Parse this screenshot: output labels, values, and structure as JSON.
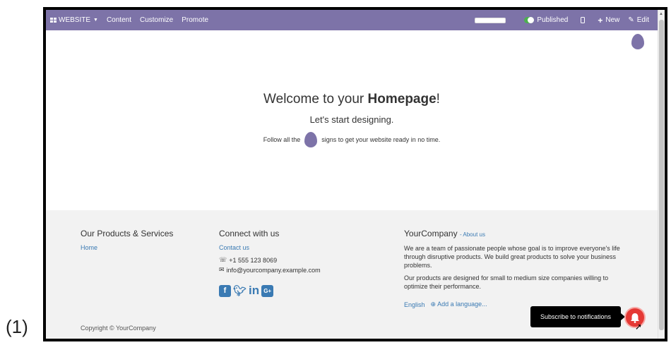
{
  "caption": "(1)",
  "topbar": {
    "website_menu": "WEBSITE",
    "content": "Content",
    "customize": "Customize",
    "promote": "Promote",
    "published": "Published",
    "new": "New",
    "edit": "Edit"
  },
  "hero": {
    "title_pre": "Welcome to your ",
    "title_bold": "Homepage",
    "title_post": "!",
    "subtitle": "Let's start designing.",
    "follow_pre": "Follow all the",
    "follow_post": "signs to get your website ready in no time."
  },
  "footer": {
    "products": {
      "heading": "Our Products & Services",
      "link": "Home"
    },
    "connect": {
      "heading": "Connect with us",
      "contact": "Contact us",
      "phone": "+1 555 123 8069",
      "email": "info@yourcompany.example.com"
    },
    "company": {
      "name": "YourCompany",
      "about": "- About us",
      "para1": "We are a team of passionate people whose goal is to improve everyone's life through disruptive products. We build great products to solve your business problems.",
      "para2": "Our products are designed for small to medium size companies willing to optimize their performance.",
      "language": "English",
      "add_language": "Add a language..."
    },
    "copyright": "Copyright © YourCompany"
  },
  "notification": {
    "tooltip": "Subscribe to notifications"
  },
  "icons": {
    "apps": "apps-grid-icon",
    "phone": "phone-icon",
    "envelope": "envelope-icon",
    "facebook": "facebook-icon",
    "twitter": "twitter-icon",
    "linkedin": "linkedin-icon",
    "google_plus": "google-plus-icon",
    "bell": "bell-icon"
  },
  "colors": {
    "navbar": "#7d73a8",
    "link": "#3a7ab3",
    "toggle_on": "#4caf50",
    "bell": "#e53935"
  }
}
